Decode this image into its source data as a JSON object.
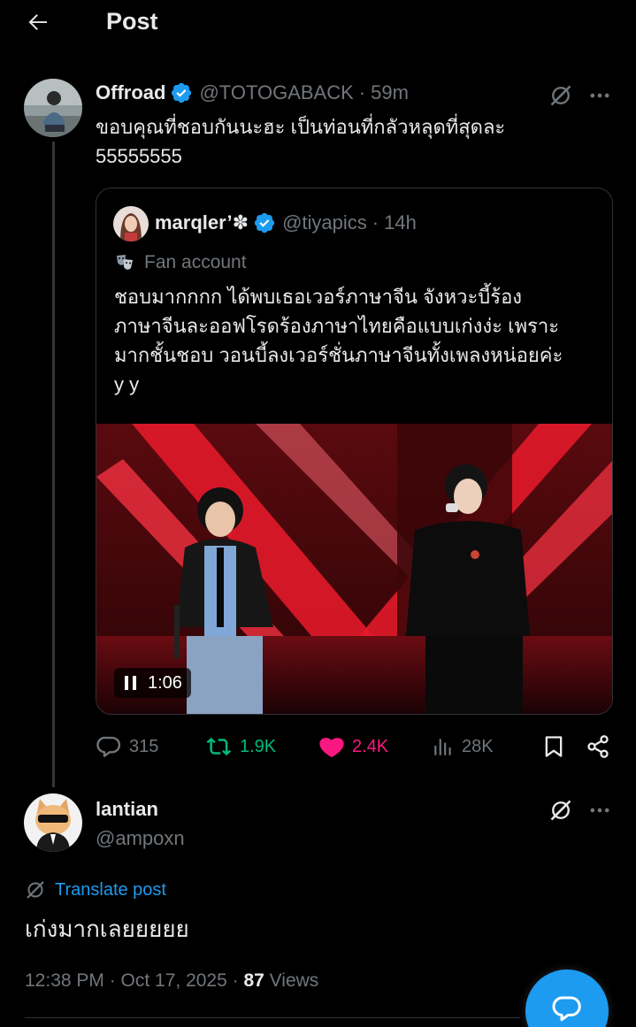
{
  "header": {
    "title": "Post"
  },
  "post": {
    "display_name": "Offroad",
    "handle": "@TOTOGABACK",
    "separator": "·",
    "time": "59m",
    "text_line1": "ขอบคุณที่ชอบกันนะฮะ เป็นท่อนที่กลัวหลุดที่สุดละ",
    "text_line2": "55555555"
  },
  "quote": {
    "display_name": "marqler’✽",
    "handle": "@tiyapics",
    "separator": "·",
    "time": "14h",
    "label": "Fan account",
    "text_line1": "ชอบมากกกก ได้พบเธอเวอร์ภาษาจีน จังหวะบี้ร้อง",
    "text_line2": "ภาษาจีนละออฟโรดร้องภาษาไทยคือแบบเก่งง่ะ เพราะ",
    "text_line3": "มากชั้นชอบ วอนบี้ลงเวอร์ชั่นภาษาจีนทั้งเพลงหน่อยค่ะ",
    "text_line4": "y y",
    "video_duration": "1:06"
  },
  "actions": {
    "replies": "315",
    "reposts": "1.9K",
    "likes": "2.4K",
    "views": "28K"
  },
  "reply": {
    "display_name": "lantian",
    "handle": "@ampoxn",
    "translate_label": "Translate post",
    "text": "เก่งมากเลยยยยย",
    "timestamp": "12:38 PM · Oct 17, 2025 ·",
    "views_count": "87",
    "views_label": "Views"
  },
  "colors": {
    "background": "#000000",
    "text": "#e7e9ea",
    "muted": "#71767b",
    "accent_blue": "#1d9bf0",
    "repost_green": "#00ba7c",
    "like_pink": "#f91880",
    "border": "#2f3336"
  }
}
